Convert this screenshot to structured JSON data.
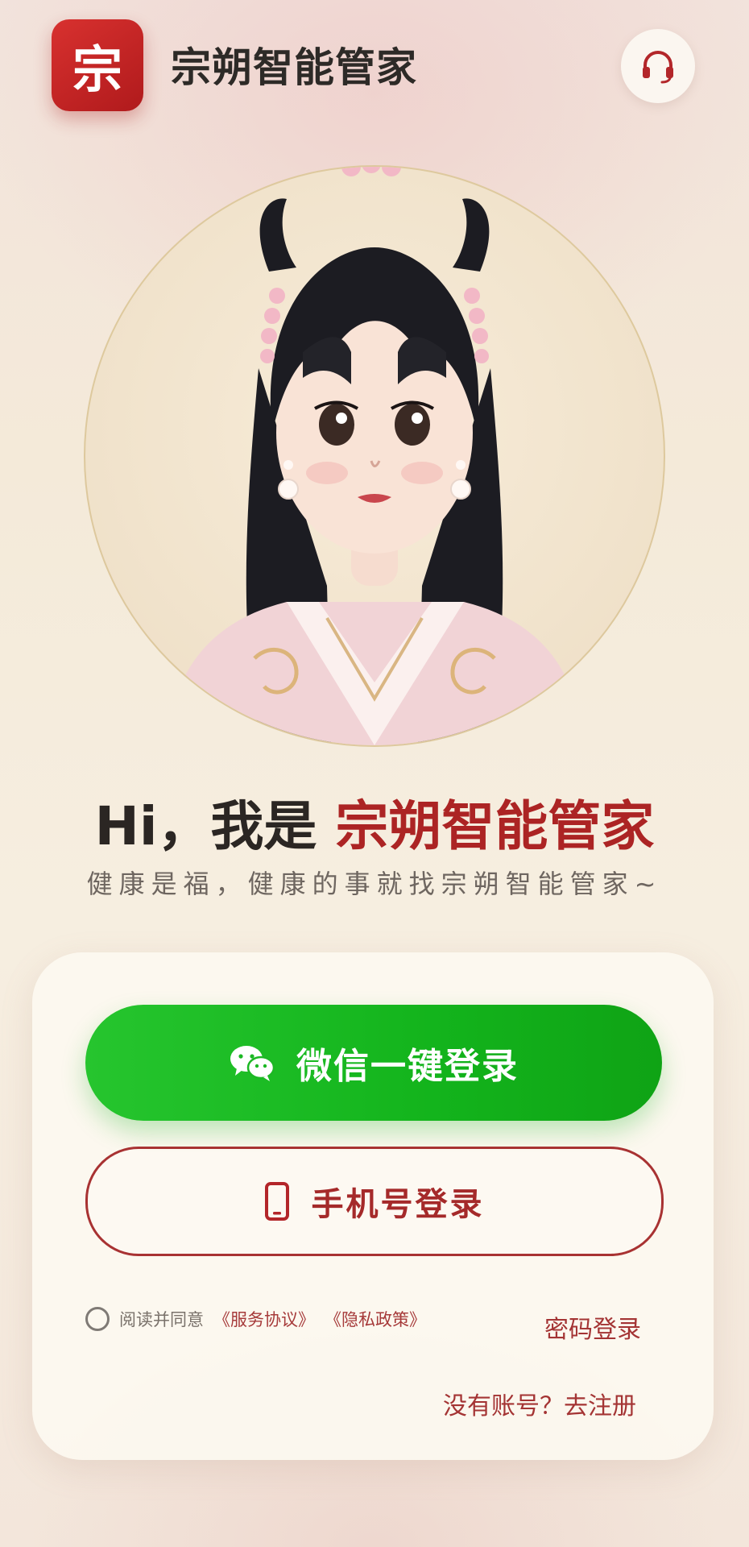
{
  "header": {
    "logo_char": "宗",
    "title": "宗朔智能管家",
    "support_icon": "headset-icon"
  },
  "avatar": {
    "icon": "assistant-avatar-portrait"
  },
  "greeting": {
    "prefix": "Hi，我是 ",
    "highlight": "宗朔智能管家",
    "highlight_color": "#ac2424"
  },
  "tagline": "健康是福，健康的事就找宗朔智能管家~",
  "login": {
    "wechat_label": "微信一键登录",
    "wechat_icon": "wechat-icon",
    "wechat_color": "#1fb427",
    "phone_label": "手机号登录",
    "phone_icon": "mobile-phone-icon",
    "accent_color": "#a83232"
  },
  "agreement": {
    "prefix": "阅读并同意",
    "service_link": "《服务协议》",
    "privacy_link": "《隐私政策》"
  },
  "links": {
    "password_login": "密码登录",
    "register": "没有账号？去注册"
  }
}
